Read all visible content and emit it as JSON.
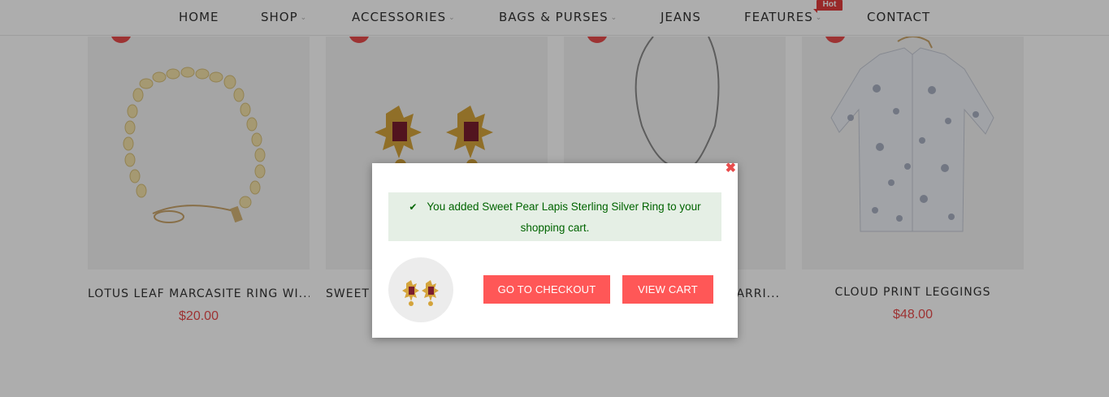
{
  "nav": {
    "items": [
      {
        "label": "HOME"
      },
      {
        "label": "SHOP"
      },
      {
        "label": "ACCESSORIES"
      },
      {
        "label": "BAGS & PURSES"
      },
      {
        "label": "JEANS"
      },
      {
        "label": "FEATURES"
      },
      {
        "label": "CONTACT"
      }
    ],
    "hot_badge": "Hot"
  },
  "products": [
    {
      "name": "LOTUS LEAF MARCASITE RING WI...",
      "price": "$20.00",
      "image_icon": "bracelet-image"
    },
    {
      "name": "SWEET",
      "image_icon": "earrings-image"
    },
    {
      "name": "ARRI...",
      "image_icon": "necklace-image"
    },
    {
      "name": "CLOUD PRINT LEGGINGS",
      "price": "$48.00",
      "image_icon": "shirt-image"
    }
  ],
  "modal": {
    "close_icon": "close-icon",
    "message": "You added Sweet Pear Lapis Sterling Silver Ring to your shopping cart.",
    "checkout_label": "GO TO CHECKOUT",
    "view_cart_label": "VIEW CART"
  },
  "colors": {
    "accent": "#ff5757",
    "price": "#e84c4c",
    "success_bg": "#e5efe5",
    "success_text": "#006400"
  }
}
